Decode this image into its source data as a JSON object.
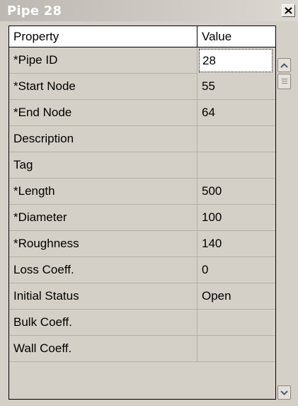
{
  "window": {
    "title": "Pipe 28"
  },
  "grid": {
    "headers": {
      "property": "Property",
      "value": "Value"
    },
    "rows": [
      {
        "property": "*Pipe ID",
        "value": "28"
      },
      {
        "property": "*Start Node",
        "value": "55"
      },
      {
        "property": "*End Node",
        "value": "64"
      },
      {
        "property": "Description",
        "value": ""
      },
      {
        "property": "Tag",
        "value": ""
      },
      {
        "property": "*Length",
        "value": "500"
      },
      {
        "property": "*Diameter",
        "value": "100"
      },
      {
        "property": "*Roughness",
        "value": "140"
      },
      {
        "property": "Loss Coeff.",
        "value": "0"
      },
      {
        "property": "Initial Status",
        "value": "Open"
      },
      {
        "property": "Bulk Coeff.",
        "value": ""
      },
      {
        "property": "Wall Coeff.",
        "value": ""
      }
    ]
  },
  "icons": {
    "close": "close-icon",
    "scroll_up": "scroll-up-icon",
    "scroll_down": "scroll-down-icon"
  }
}
